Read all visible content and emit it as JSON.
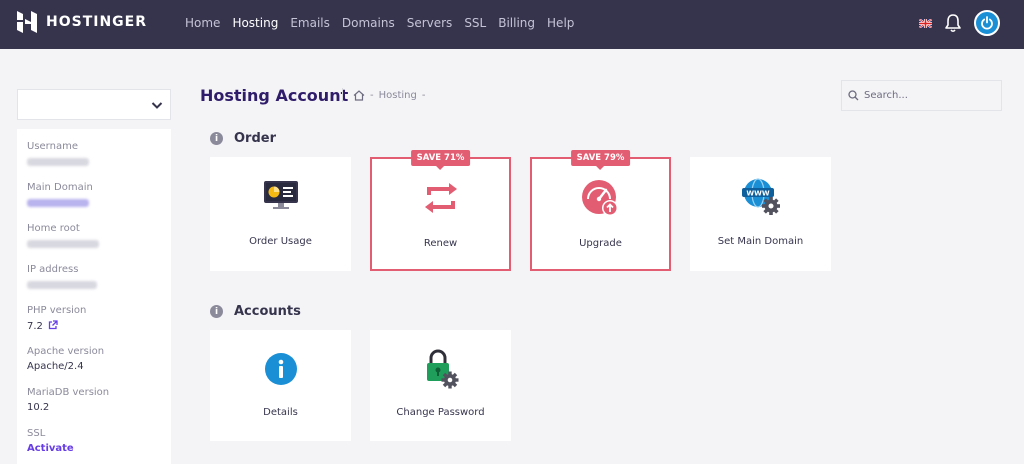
{
  "brand": {
    "name": "HOSTINGER"
  },
  "nav": {
    "items": [
      {
        "label": "Home"
      },
      {
        "label": "Hosting",
        "active": true
      },
      {
        "label": "Emails"
      },
      {
        "label": "Domains"
      },
      {
        "label": "Servers"
      },
      {
        "label": "SSL"
      },
      {
        "label": "Billing"
      },
      {
        "label": "Help"
      }
    ]
  },
  "header": {
    "title": "Hosting Account",
    "breadcrumb": [
      "Hosting"
    ],
    "breadcrumb_separator": "-"
  },
  "search": {
    "placeholder": "Search..."
  },
  "sidebar": {
    "labels": {
      "username": "Username",
      "main_domain": "Main Domain",
      "home_root": "Home root",
      "ip_address": "IP address",
      "php_version": "PHP version",
      "apache_version": "Apache version",
      "mariadb_version": "MariaDB version",
      "ssl": "SSL"
    },
    "values": {
      "php_version": "7.2",
      "apache_version": "Apache/2.4",
      "mariadb_version": "10.2",
      "ssl": "Activate"
    }
  },
  "sections": {
    "order": {
      "title": "Order",
      "cards": {
        "order_usage": {
          "label": "Order Usage"
        },
        "renew": {
          "label": "Renew",
          "badge": "SAVE 71%"
        },
        "upgrade": {
          "label": "Upgrade",
          "badge": "SAVE 79%"
        },
        "set_main_domain": {
          "label": "Set Main Domain"
        }
      }
    },
    "accounts": {
      "title": "Accounts",
      "cards": {
        "details": {
          "label": "Details"
        },
        "change_password": {
          "label": "Change Password"
        }
      }
    }
  },
  "icons": {
    "section": "info-icon",
    "accent": "#673de6",
    "promo": "#e25d72",
    "nav_bg": "#36344d"
  }
}
